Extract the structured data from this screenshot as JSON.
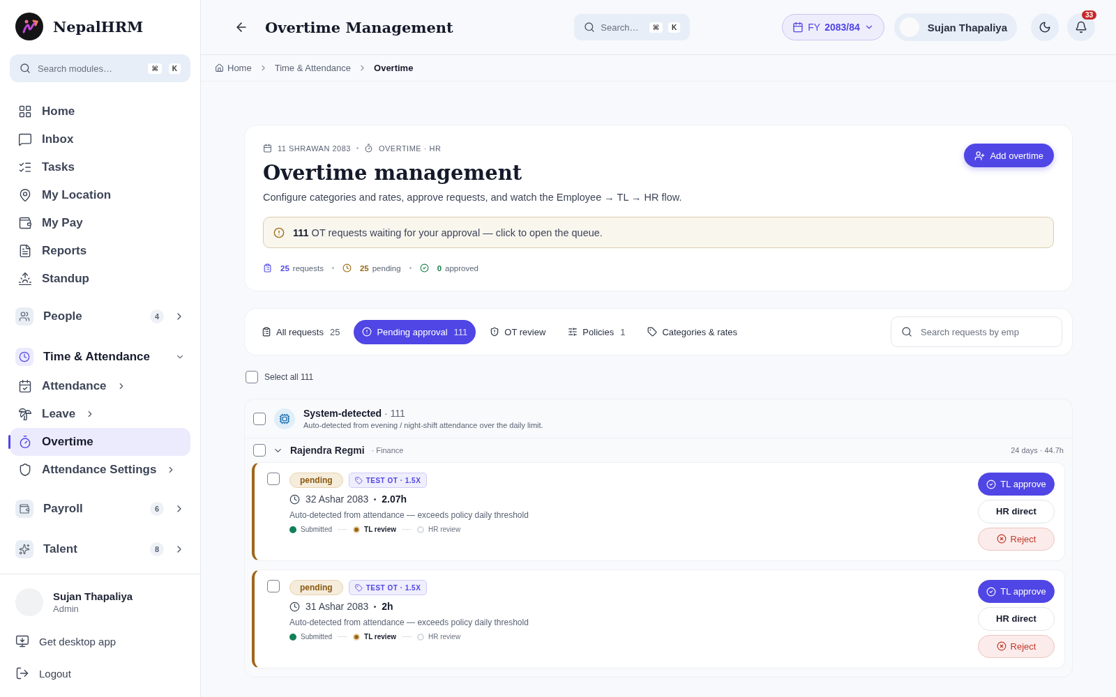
{
  "brand": {
    "name": "NepalHRM"
  },
  "sidebar": {
    "search": {
      "placeholder": "Search modules…",
      "keys": [
        "⌘",
        "K"
      ]
    },
    "items": [
      {
        "label": "Home",
        "selected": false
      },
      {
        "label": "Inbox",
        "selected": false
      },
      {
        "label": "Tasks",
        "selected": false
      },
      {
        "label": "My Location",
        "selected": false
      },
      {
        "label": "My Pay",
        "selected": false
      },
      {
        "label": "Reports",
        "selected": false
      },
      {
        "label": "Standup",
        "selected": false
      }
    ],
    "groups": [
      {
        "label": "People",
        "badge": "4",
        "expanded": false
      },
      {
        "label": "Time & Attendance",
        "expanded": true,
        "children": [
          {
            "label": "Attendance",
            "selected": false,
            "has_submenu": true
          },
          {
            "label": "Leave",
            "selected": false,
            "has_submenu": true
          },
          {
            "label": "Overtime",
            "selected": true,
            "has_submenu": false
          },
          {
            "label": "Attendance Settings",
            "selected": false,
            "has_submenu": true
          }
        ]
      },
      {
        "label": "Payroll",
        "badge": "6",
        "expanded": false
      },
      {
        "label": "Talent",
        "badge": "8",
        "expanded": false
      }
    ],
    "user": {
      "name": "Sujan Thapaliya",
      "role": "Admin"
    },
    "footer_links": [
      "Get desktop app",
      "Logout"
    ]
  },
  "header": {
    "title": "Overtime Management",
    "search": {
      "placeholder": "Search…",
      "keys": [
        "⌘",
        "K"
      ]
    },
    "fiscal_year": {
      "prefix": "FY",
      "value": "2083/84"
    },
    "user": "Sujan Thapaliya",
    "notifications": "33"
  },
  "breadcrumb": [
    "Home",
    "Time & Attendance",
    "Overtime"
  ],
  "hero": {
    "date": "11 SHRAWAN 2083",
    "section": "OVERTIME · HR",
    "title": "Overtime management",
    "subtitle": "Configure categories and rates, approve requests, and watch the Employee → TL → HR flow.",
    "alert": "**111** OT requests waiting for your approval — click to open the queue.",
    "add_button": "Add overtime",
    "stats": [
      {
        "kind": "requests",
        "value": "25",
        "label": "requests"
      },
      {
        "kind": "pending",
        "value": "25",
        "label": "pending"
      },
      {
        "kind": "approved",
        "value": "0",
        "label": "approved"
      }
    ]
  },
  "tabs": [
    {
      "label": "All requests",
      "count": "25",
      "selected": false
    },
    {
      "label": "Pending approval",
      "count": "111",
      "selected": true
    },
    {
      "label": "OT review",
      "selected": false
    },
    {
      "label": "Policies",
      "count": "1",
      "selected": false
    },
    {
      "label": "Categories & rates",
      "selected": false
    }
  ],
  "request_search": {
    "placeholder": "Search requests by emp"
  },
  "select_all": {
    "label": "Select all 111",
    "checked": false
  },
  "source_group": {
    "title": "System-detected",
    "count": "· 111",
    "description": "Auto-detected from evening / night-shift attendance over the daily limit.",
    "checked": false
  },
  "employee": {
    "name": "Rajendra Regmi",
    "department": "· Finance",
    "summary": "24 days · 44.7h",
    "checked": false,
    "expanded": true
  },
  "requests": [
    {
      "status": "pending",
      "category": "TEST OT · 1.5X",
      "date": "32 Ashar 2083",
      "hours": "2.07h",
      "note": "Auto-detected from attendance — exceeds policy daily threshold",
      "checked": false,
      "steps": [
        {
          "label": "Submitted",
          "done": true,
          "current": false
        },
        {
          "label": "TL review",
          "done": false,
          "current": true
        },
        {
          "label": "HR review",
          "done": false,
          "current": false
        }
      ],
      "actions": [
        "TL approve",
        "HR direct",
        "Reject"
      ]
    },
    {
      "status": "pending",
      "category": "TEST OT · 1.5X",
      "date": "31 Ashar 2083",
      "hours": "2h",
      "note": "Auto-detected from attendance — exceeds policy daily threshold",
      "checked": false,
      "steps": [
        {
          "label": "Submitted",
          "done": true,
          "current": false
        },
        {
          "label": "TL review",
          "done": false,
          "current": true
        },
        {
          "label": "HR review",
          "done": false,
          "current": false
        }
      ],
      "actions": [
        "TL approve",
        "HR direct",
        "Reject"
      ]
    }
  ]
}
